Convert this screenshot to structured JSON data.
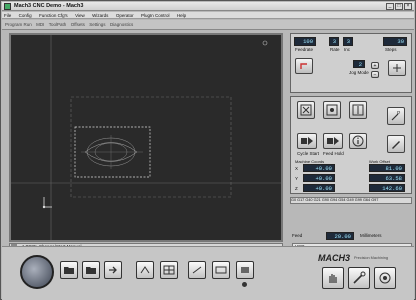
{
  "window": {
    "title": "Mach3 CNC Demo - Mach3",
    "minimize": "_",
    "maximize": "□",
    "close": "×"
  },
  "menu": [
    "File",
    "Config",
    "Function Cfg's",
    "View",
    "Wizards",
    "Operator",
    "PlugIn Control",
    "Help"
  ],
  "tabs": [
    "Program Run",
    "MDI",
    "ToolPath",
    "Offsets",
    "Settings",
    "Diagnostics"
  ],
  "right_top": {
    "left_value": "100",
    "left_label": "Feedrate",
    "mid_values": [
      "3",
      "3"
    ],
    "mid_labels": [
      "Rate",
      "Inc"
    ],
    "right_value": "30",
    "right_label": "Steps",
    "jog_value": "2",
    "jog_label": "Jog Mode"
  },
  "dro": {
    "x_label": "X",
    "x_left": "+0.00",
    "x_right": "81.00",
    "y_label": "Y",
    "y_left": "+0.00",
    "y_right": "63.58",
    "z_label": "Z",
    "z_left": "+0.00",
    "z_right": "142.60",
    "col_left": "Machine Coords",
    "col_right": "Work Offset"
  },
  "cycle_label": "Cycle Start",
  "feed_label": "Feed Hold",
  "status_line": "G0 G17 G40 G21 G90 G94 G54 G49 G99 G64 G97",
  "gcode_line": "1 TOOL Change/Start Manual",
  "lower": {
    "feed_label": "Feed",
    "feed_value": "20.00",
    "units_label": "Millimeters",
    "status_label": "VCR"
  },
  "brand": {
    "name": "MACH3",
    "sub": "Precision Machining"
  },
  "colors": {
    "toolpath_bg": "#2a2a2a",
    "dro_bg": "#1e2a3a",
    "dro_text": "#9fe8ff"
  }
}
